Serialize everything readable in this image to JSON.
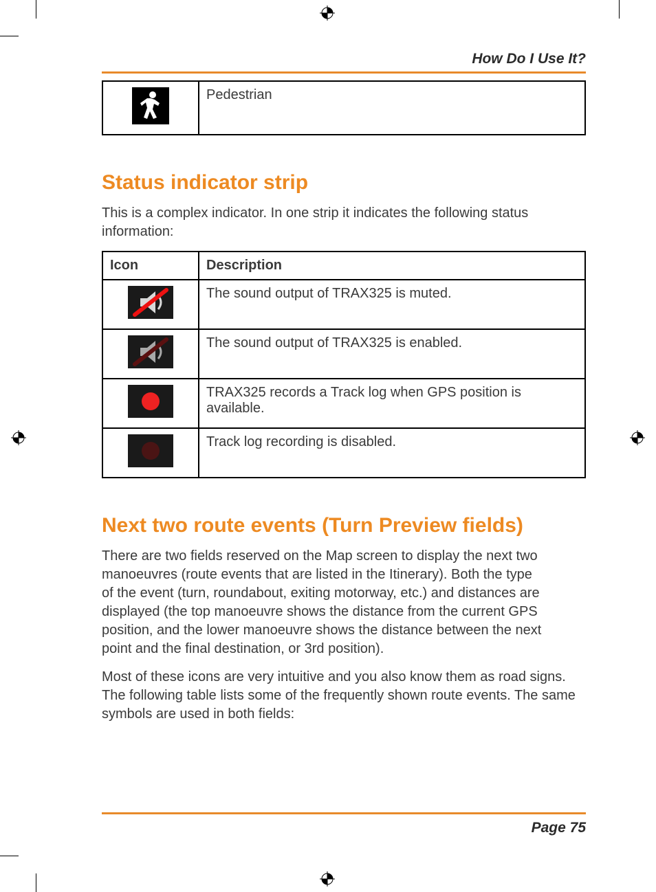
{
  "header": {
    "running_head": "How Do I Use It?"
  },
  "table_pedestrian": {
    "cell_label": "Pedestrian",
    "icon_name": "pedestrian-icon"
  },
  "section_status": {
    "heading": "Status indicator strip",
    "intro": "This is a complex indicator. In one strip it indicates the following status information:",
    "table": {
      "head_icon": "Icon",
      "head_desc": "Description",
      "rows": [
        {
          "icon_name": "sound-muted-icon",
          "desc": "The sound output of TRAX325 is muted."
        },
        {
          "icon_name": "sound-enabled-icon",
          "desc": "The sound output of TRAX325 is enabled."
        },
        {
          "icon_name": "tracklog-on-icon",
          "desc": "TRAX325 records a Track log when GPS position is available."
        },
        {
          "icon_name": "tracklog-off-icon",
          "desc": "Track log recording is disabled."
        }
      ]
    }
  },
  "section_next": {
    "heading": "Next two route events (Turn Preview fields)",
    "p1": "There are two fields reserved on the Map screen to display the next two manoeuvres (route events that are listed in the Itinerary). Both the type of the event (turn, roundabout, exiting motorway, etc.) and distances are displayed (the top manoeuvre shows the distance from the current GPS position, and the lower manoeuvre shows the distance between the next point and the final destination, or 3rd position).",
    "p2": "Most of these icons are very intuitive and you also know them as road signs. The following table lists some of the frequently shown route events. The same symbols are used in both fields:"
  },
  "footer": {
    "page_label": "Page 75"
  }
}
